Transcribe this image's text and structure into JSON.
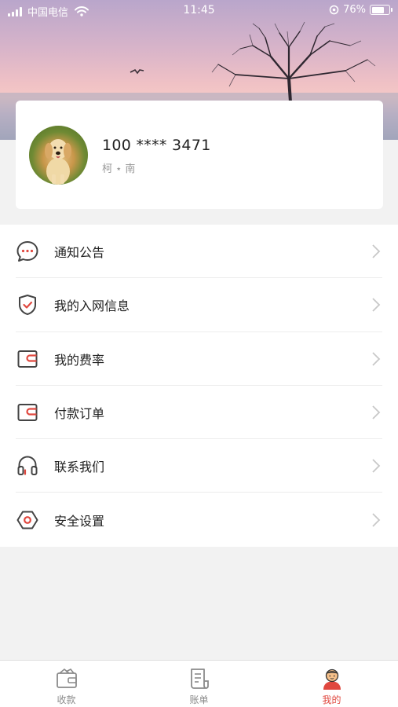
{
  "status_bar": {
    "carrier": "中国电信",
    "time": "11:45",
    "battery_percent_label": "76%",
    "battery_level": 0.76
  },
  "profile": {
    "phone": "100 **** 3471",
    "name": "柯 ⋆ 南"
  },
  "menu": {
    "items": [
      {
        "label": "通知公告",
        "icon": "message-bubble-icon"
      },
      {
        "label": "我的入网信息",
        "icon": "shield-check-icon"
      },
      {
        "label": "我的费率",
        "icon": "wallet-icon"
      },
      {
        "label": "付款订单",
        "icon": "wallet-icon"
      },
      {
        "label": "联系我们",
        "icon": "headset-icon"
      },
      {
        "label": "安全设置",
        "icon": "hexagon-settings-icon"
      }
    ]
  },
  "tab_bar": {
    "tabs": [
      {
        "label": "收款",
        "icon": "wallet-icon",
        "active": false
      },
      {
        "label": "账单",
        "icon": "bill-icon",
        "active": false
      },
      {
        "label": "我的",
        "icon": "user-avatar-icon",
        "active": true
      }
    ]
  },
  "colors": {
    "accent": "#e0483f",
    "icon_stroke": "#444444",
    "chevron": "#c8c8c8"
  }
}
